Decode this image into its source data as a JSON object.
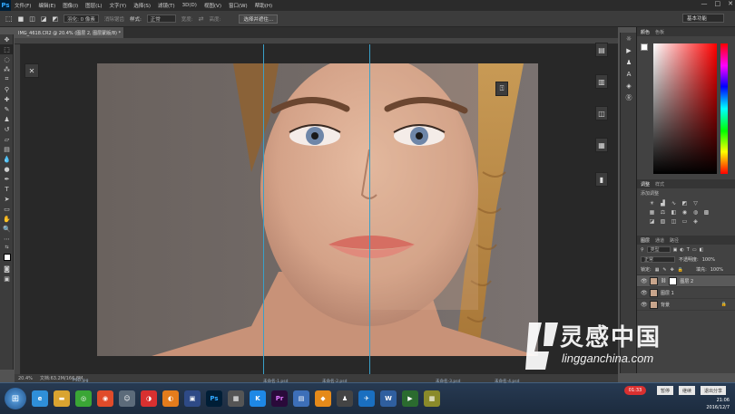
{
  "menubar": {
    "logo": "Ps",
    "items": [
      "文件(F)",
      "编辑(E)",
      "图像(I)",
      "图层(L)",
      "文字(Y)",
      "选择(S)",
      "滤镜(T)",
      "3D(D)",
      "视图(V)",
      "窗口(W)",
      "帮助(H)"
    ],
    "window_controls": [
      "—",
      "□",
      "✕"
    ]
  },
  "options": {
    "feather": "羽化: 0 像素",
    "antialias": "消除锯齿",
    "style_label": "样式:",
    "style_value": "正常",
    "width_label": "宽度:",
    "height_label": "高度:",
    "select_and_mask": "选择并遮住...",
    "workspace": "基本功能"
  },
  "document": {
    "tab_title": "IMG_4618.CR2 @ 20.4% (图层 2, 图层蒙版/8) *",
    "zoom": "20.4%",
    "doc_size": "文档:63.2M/166.8M"
  },
  "panels": {
    "color_tabs": [
      "颜色",
      "色板"
    ],
    "adjust_tabs": [
      "调整",
      "样式"
    ],
    "adjust_hint": "添加调整",
    "layers_tabs": [
      "图层",
      "通道",
      "路径"
    ],
    "layer_kind": "类型",
    "blend_mode": "正常",
    "opacity_label": "不透明度:",
    "opacity_value": "100%",
    "lock_label": "锁定:",
    "fill_label": "填充:",
    "fill_value": "100%",
    "layers": [
      {
        "name": "图层 2",
        "selected": true,
        "mask": true
      },
      {
        "name": "图层 1",
        "selected": false,
        "mask": false
      },
      {
        "name": "背景",
        "selected": false,
        "mask": false
      }
    ]
  },
  "taskbar": {
    "labels": [
      "PSD.jpg",
      "未命名-1.psd",
      "未命名-2.psd",
      "未命名-3.psd",
      "未命名-4.psd"
    ],
    "record_time": "01:33",
    "tray_buttons": [
      "暂停",
      "继续",
      "退出分享"
    ],
    "time": "21:06",
    "date": "2016/12/7"
  },
  "watermark": {
    "title": "灵感中国",
    "url": "lingganchina.com"
  }
}
